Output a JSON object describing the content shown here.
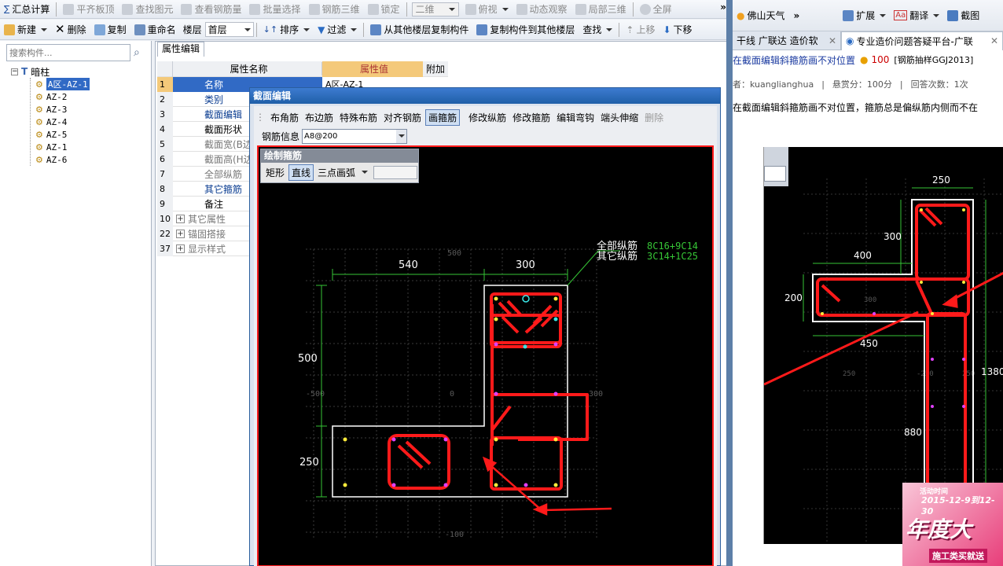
{
  "app": {
    "toolbar1": {
      "items": [
        {
          "label": "汇总计算",
          "icon": "sigma-icon",
          "enabled": true
        },
        {
          "label": "平齐板顶",
          "icon": "align-top-icon",
          "enabled": false
        },
        {
          "label": "查找图元",
          "icon": "find-element-icon",
          "enabled": false
        },
        {
          "label": "查看钢筋量",
          "icon": "view-rebar-icon",
          "enabled": false
        },
        {
          "label": "批量选择",
          "icon": "batch-select-icon",
          "enabled": false
        },
        {
          "label": "钢筋三维",
          "icon": "rebar-3d-icon",
          "enabled": false
        },
        {
          "label": "锁定",
          "icon": "lock-icon",
          "enabled": false
        }
      ],
      "view_select": "二维",
      "view_items": [
        {
          "label": "俯视",
          "icon": "top-view-icon"
        },
        {
          "label": "动态观察",
          "icon": "orbit-icon"
        },
        {
          "label": "局部三维",
          "icon": "local-3d-icon"
        },
        {
          "label": "全屏",
          "icon": "fullscreen-icon"
        }
      ],
      "overflow": "»"
    },
    "toolbar2": {
      "new": "新建",
      "delete": "删除",
      "copy": "复制",
      "rename": "重命名",
      "floor_label": "楼层",
      "floor_value": "首层",
      "sort": "排序",
      "filter": "过滤",
      "copy_from_floor": "从其他楼层复制构件",
      "copy_to_floor": "复制构件到其他楼层",
      "find": "查找",
      "move_up": "上移",
      "move_down": "下移"
    },
    "search": {
      "placeholder": "搜索构件..."
    },
    "tree": {
      "root": "暗柱",
      "items": [
        "A区-AZ-1",
        "AZ-2",
        "AZ-3",
        "AZ-4",
        "AZ-5",
        "AZ-1",
        "AZ-6"
      ],
      "selected_index": 0
    },
    "prop_tab": "属性编辑",
    "prop_grid": {
      "headers": [
        "属性名称",
        "属性值",
        "附加"
      ],
      "rows": [
        {
          "num": "1",
          "name": "名称",
          "value": "A区-AZ-1",
          "link": false,
          "selected": true
        },
        {
          "num": "2",
          "name": "类别",
          "value": "",
          "link": true
        },
        {
          "num": "3",
          "name": "截面编辑",
          "value": "",
          "link": true
        },
        {
          "num": "4",
          "name": "截面形状",
          "value": "",
          "link": false
        },
        {
          "num": "5",
          "name": "截面宽(B边)(",
          "value": "",
          "link": false,
          "gray": true
        },
        {
          "num": "6",
          "name": "截面高(H边)(",
          "value": "",
          "link": false,
          "gray": true
        },
        {
          "num": "7",
          "name": "全部纵筋",
          "value": "",
          "link": false,
          "gray": true
        },
        {
          "num": "8",
          "name": "其它箍筋",
          "value": "",
          "link": true
        },
        {
          "num": "9",
          "name": "备注",
          "value": "",
          "link": false
        },
        {
          "num": "10",
          "name": "其它属性",
          "value": "",
          "expand": true,
          "gray": true
        },
        {
          "num": "22",
          "name": "锚固搭接",
          "value": "",
          "expand": true,
          "gray": true
        },
        {
          "num": "37",
          "name": "显示样式",
          "value": "",
          "expand": true,
          "gray": true
        }
      ]
    },
    "dialog": {
      "title": "截面编辑",
      "tabs": [
        "布角筋",
        "布边筋",
        "特殊布筋",
        "对齐钢筋",
        "画箍筋",
        "修改纵筋",
        "修改箍筋",
        "编辑弯钩",
        "端头伸缩",
        "删除"
      ],
      "active_tab": "画箍筋",
      "disabled_tab": "删除",
      "rebar_info_label": "钢筋信息",
      "rebar_info_value": "A8@200",
      "draw_panel_title": "绘制箍筋",
      "draw_modes": [
        "矩形",
        "直线",
        "三点画弧"
      ],
      "draw_mode_active": "直线",
      "dims": {
        "top_left": "540",
        "top_right": "300",
        "left_upper": "500",
        "left_lower": "250"
      },
      "faint": {
        "top": "500",
        "left": "-500",
        "center": "0",
        "right": "300",
        "bottom": "-100"
      },
      "rebar_text": {
        "all_label": "全部纵筋",
        "all_value": "8C16+9C14",
        "other_label": "其它纵筋",
        "other_value": "3C14+1C25"
      }
    }
  },
  "browser": {
    "toolbar": {
      "weather": "佛山天气",
      "expand": "扩展",
      "translate": "翻译",
      "screenshot": "截图",
      "chevrons": "»"
    },
    "tabs": [
      {
        "label": "干线 广联达 造价软",
        "active": false
      },
      {
        "label": "专业造价问题答疑平台-广联",
        "active": true
      }
    ],
    "question": {
      "title": "在截面编辑斜箍筋画不对位置",
      "reward_value": "100",
      "tag": "[钢筋抽样GGJ2013]",
      "author_label": "者：kuanglianghua",
      "bounty": "悬赏分：100分",
      "answers": "回答次数：1次",
      "body": "在截面编辑斜箍筋画不对位置，箍筋总是偏纵筋内侧而不在"
    },
    "cad": {
      "dims": {
        "a": "250",
        "b": "300",
        "c": "400",
        "d": "200",
        "e": "450",
        "f": "880",
        "g": "1380"
      },
      "faint": {
        "a": "300",
        "b": "250",
        "c": "250",
        "d": "-250"
      }
    },
    "ad": {
      "date": "2015-12-9到12-30",
      "sub": "活动时间",
      "headline": "年度大",
      "bottom": "施工类买就送"
    }
  },
  "colors": {
    "accent_red": "#ff1a1a",
    "dim_green": "#36c536",
    "cad_bg": "#000000",
    "dialog_title": "#1f5fa8"
  }
}
